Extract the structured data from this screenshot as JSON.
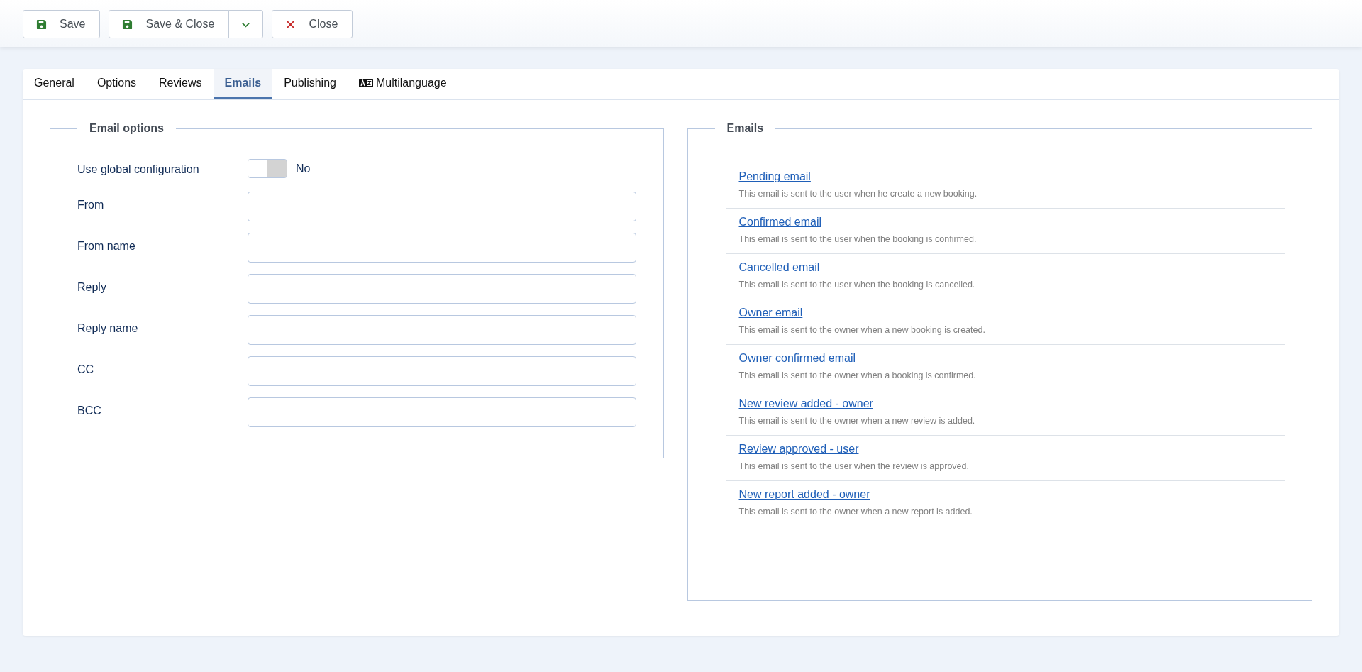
{
  "toolbar": [
    {
      "label": "Save",
      "kind": "save"
    },
    {
      "label": "Save & Close",
      "kind": "save-split"
    },
    {
      "label": "Close",
      "kind": "close"
    }
  ],
  "tabs": [
    {
      "label": "General",
      "selected": false,
      "kind": "text"
    },
    {
      "label": "Options",
      "selected": false,
      "kind": "text"
    },
    {
      "label": "Reviews",
      "selected": false,
      "kind": "text"
    },
    {
      "label": "Emails",
      "selected": true,
      "kind": "text"
    },
    {
      "label": "Publishing",
      "selected": false,
      "kind": "text"
    },
    {
      "label": "Multilanguage",
      "selected": false,
      "kind": "language"
    }
  ],
  "email_options": {
    "legend": "Email options",
    "global": {
      "label": "Use global configuration",
      "on": false,
      "value": "No"
    },
    "fields": [
      {
        "label": "From"
      },
      {
        "label": "From name"
      },
      {
        "label": "Reply"
      },
      {
        "label": "Reply name"
      },
      {
        "label": "CC"
      },
      {
        "label": "BCC"
      }
    ]
  },
  "emails": {
    "legend": "Emails",
    "items": [
      {
        "title": "Pending email",
        "description": "This email is sent to the user when he create a new booking."
      },
      {
        "title": "Confirmed email",
        "description": "This email is sent to the user when the booking is confirmed."
      },
      {
        "title": "Cancelled email",
        "description": "This email is sent to the user when the booking is cancelled."
      },
      {
        "title": "Owner email",
        "description": "This email is sent to the owner when a new booking is created."
      },
      {
        "title": "Owner confirmed email",
        "description": "This email is sent to the owner when a booking is confirmed."
      },
      {
        "title": "New review added - owner",
        "description": "This email is sent to the owner when a new review is added."
      },
      {
        "title": "Review approved - user",
        "description": "This email is sent to the user when the review is approved."
      },
      {
        "title": "New report added - owner",
        "description": "This email is sent to the owner when a new report is added."
      }
    ]
  }
}
